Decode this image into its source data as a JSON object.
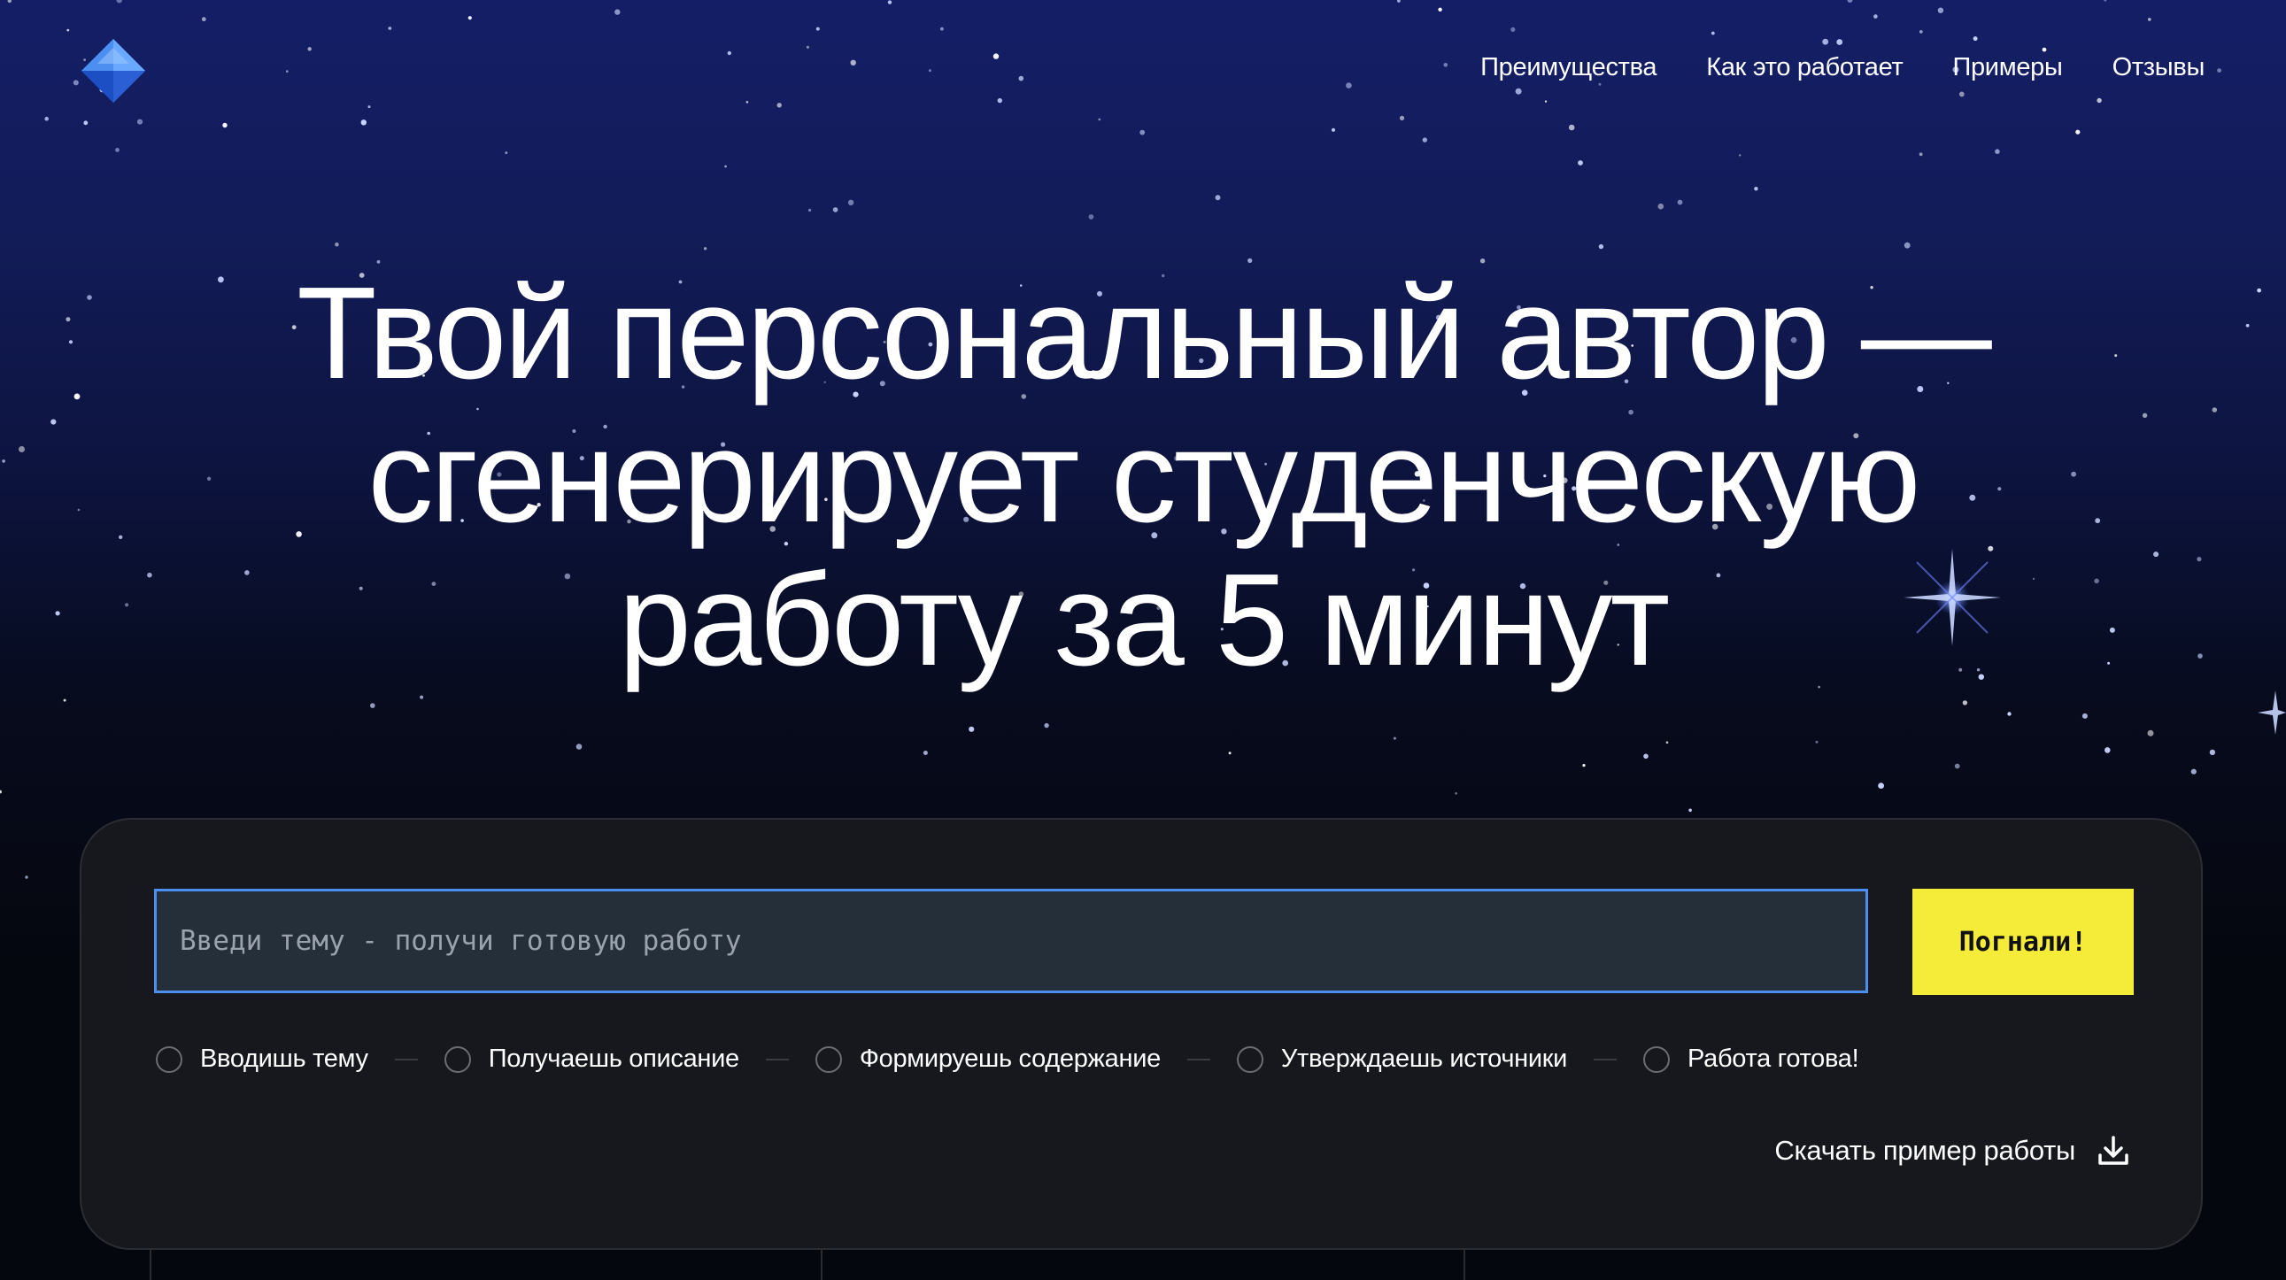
{
  "nav": {
    "items": [
      "Преимущества",
      "Как это работает",
      "Примеры",
      "Отзывы"
    ]
  },
  "hero": {
    "lines": [
      "Твой персональный автор —",
      "сгенерирует студенческую",
      "работу за 5 минут"
    ]
  },
  "form": {
    "placeholder": "Введи тему - получи готовую работу",
    "submit_label": "Погнали!"
  },
  "steps": [
    "Вводишь тему",
    "Получаешь описание",
    "Формируешь содержание",
    "Утверждаешь источники",
    "Работа готова!"
  ],
  "download": {
    "label": "Скачать пример работы",
    "icon": "download-icon"
  },
  "colors": {
    "accent": "#f5ec3a",
    "input_border": "#4c8ff0",
    "card_bg": "#17181d",
    "sky_top": "#141e66"
  },
  "icons": {
    "logo": "diamond-logo-icon"
  }
}
